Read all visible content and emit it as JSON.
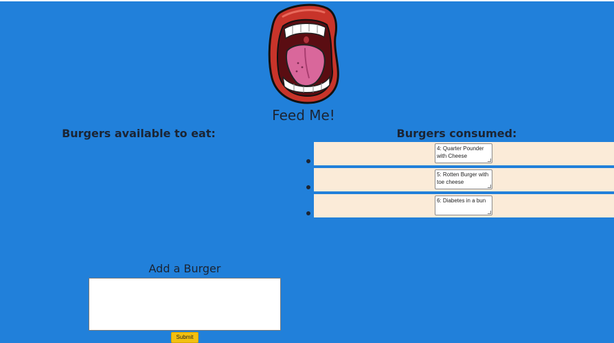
{
  "header": {
    "title": "Feed Me!",
    "logo_icon": "open-mouth-icon"
  },
  "available": {
    "heading": "Burgers available to eat:",
    "items": []
  },
  "consumed": {
    "heading": "Burgers consumed:",
    "items": [
      {
        "text": "4: Quarter Pounder with Cheese"
      },
      {
        "text": "5: Rotten Burger with toe cheese"
      },
      {
        "text": "6: Diabetes in a bun"
      }
    ]
  },
  "form": {
    "heading": "Add a Burger",
    "input_value": "",
    "submit_label": "Submit"
  },
  "colors": {
    "background": "#2180da",
    "item_background": "#fbebd8",
    "button": "#f2c010"
  }
}
